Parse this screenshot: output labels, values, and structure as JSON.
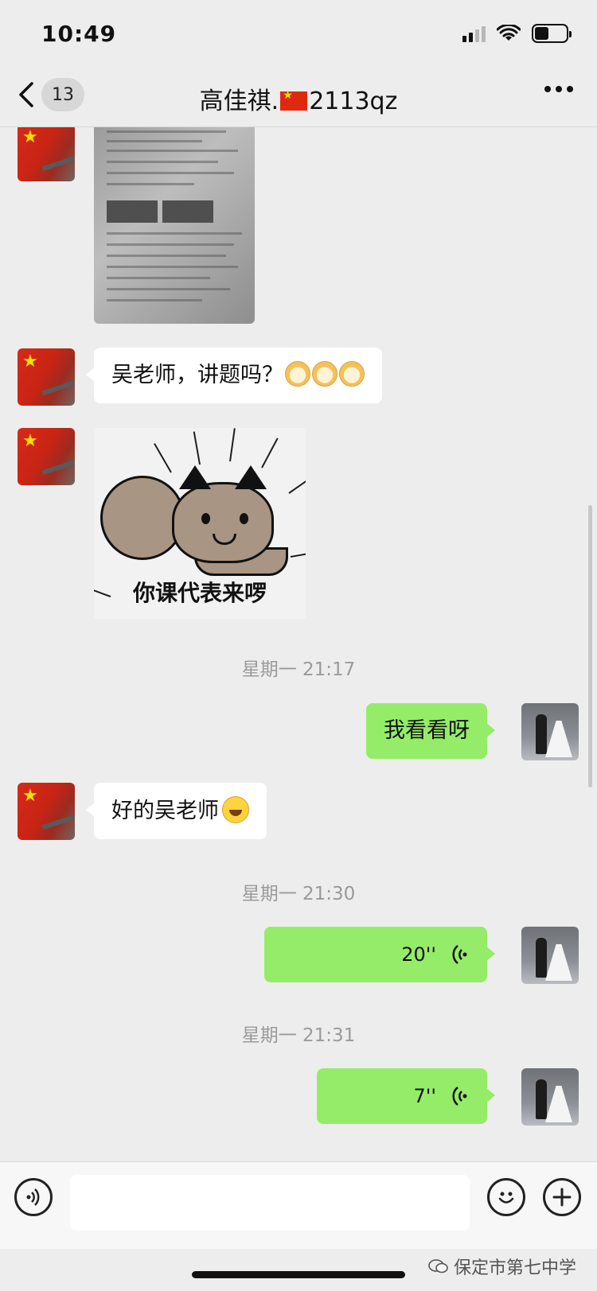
{
  "status_bar": {
    "time": "10:49"
  },
  "nav": {
    "unread_count": "13",
    "title_prefix": "高佳祺.",
    "title_suffix": "2113qz"
  },
  "messages": [
    {
      "type": "image",
      "side": "left",
      "content": "试卷照片"
    },
    {
      "type": "text",
      "side": "left",
      "text": "吴老师，讲题吗？"
    },
    {
      "type": "sticker",
      "side": "left",
      "caption": "你课代表来啰"
    },
    {
      "type": "timestamp",
      "text": "星期一 21:17"
    },
    {
      "type": "text",
      "side": "right",
      "text": "我看看呀"
    },
    {
      "type": "text",
      "side": "left",
      "text": "好的吴老师"
    },
    {
      "type": "timestamp",
      "text": "星期一 21:30"
    },
    {
      "type": "voice",
      "side": "right",
      "duration": "20''"
    },
    {
      "type": "timestamp",
      "text": "星期一 21:31"
    },
    {
      "type": "voice",
      "side": "right",
      "duration": "7''"
    }
  ],
  "input": {
    "placeholder": ""
  },
  "watermark": "保定市第七中学",
  "colors": {
    "background": "#ededed",
    "bubble_right": "#95ec69",
    "bubble_left": "#ffffff"
  },
  "icons": [
    "back-chevron-icon",
    "more-icon",
    "voice-mode-icon",
    "emoji-icon",
    "plus-icon",
    "voice-wave-icon"
  ]
}
